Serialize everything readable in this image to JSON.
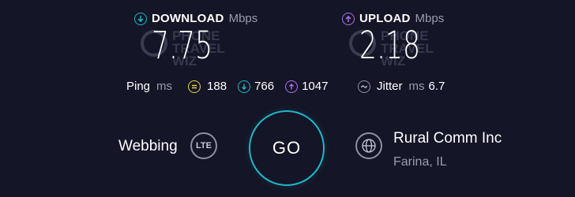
{
  "download": {
    "title": "DOWNLOAD",
    "unit": "Mbps",
    "value": "7.75",
    "color": "#1fb8c9",
    "icon": "arrow-down-circle-icon"
  },
  "upload": {
    "title": "UPLOAD",
    "unit": "Mbps",
    "value": "2.18",
    "color": "#b070f0",
    "icon": "arrow-up-circle-icon"
  },
  "watermark": {
    "line1": "PHONE",
    "line2": "TRAVEL",
    "line3": "WIZ"
  },
  "ping": {
    "label": "Ping",
    "unit": "ms",
    "idle": "188",
    "download": "766",
    "upload": "1047",
    "idle_color": "#e6d34a",
    "download_color": "#1fb8c9",
    "upload_color": "#b070f0"
  },
  "jitter": {
    "label": "Jitter",
    "unit": "ms",
    "value": "6.7"
  },
  "go_label": "GO",
  "connection": {
    "name": "Webbing",
    "type": "LTE"
  },
  "provider": {
    "name": "Rural Comm Inc",
    "location": "Farina, IL"
  }
}
